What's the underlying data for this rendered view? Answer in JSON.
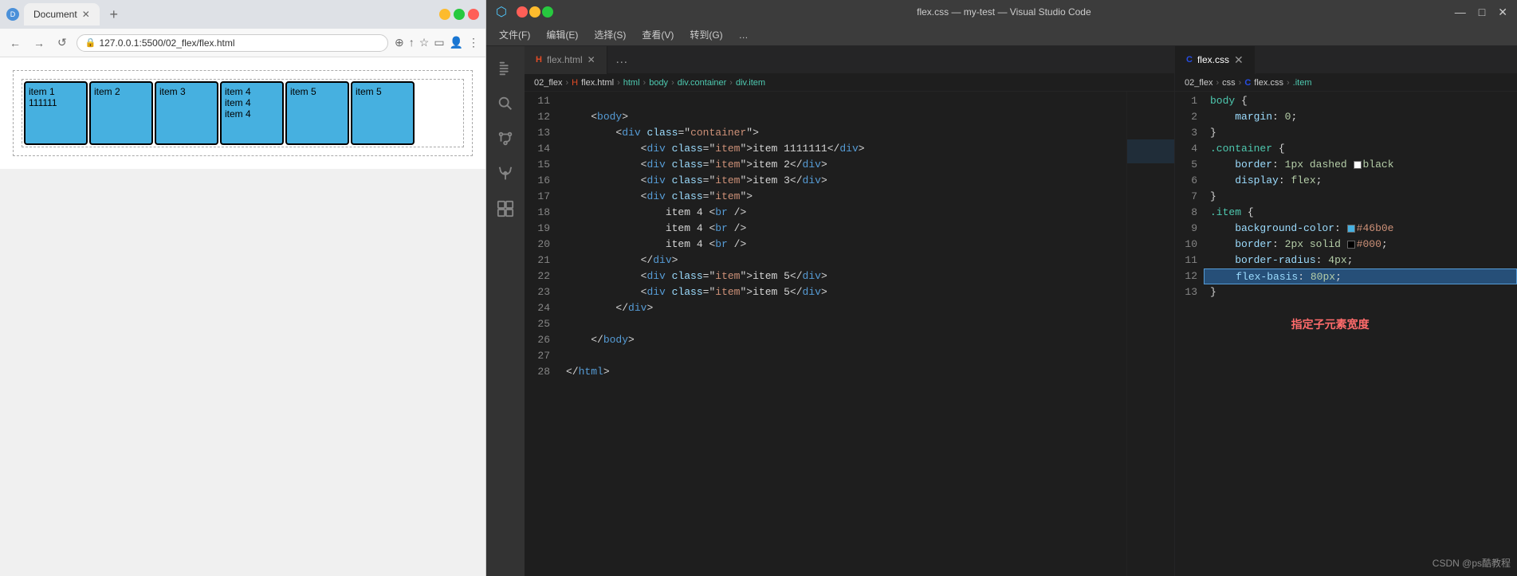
{
  "browser": {
    "tab_title": "Document",
    "url": "127.0.0.1:5500/02_flex/flex.html",
    "favicon": "⊕"
  },
  "preview": {
    "items": [
      {
        "label": "item 1111111",
        "tall": true
      },
      {
        "label": "item 2",
        "tall": false
      },
      {
        "label": "item 3",
        "tall": false
      },
      {
        "label": "item 4\nitem 4\nitem 4",
        "tall": true
      },
      {
        "label": "item 5",
        "tall": false
      },
      {
        "label": "item 5",
        "tall": false
      }
    ]
  },
  "vscode": {
    "title": "flex.css — my-test — Visual Studio Code",
    "menu": [
      "文件(F)",
      "编辑(E)",
      "选择(S)",
      "查看(V)",
      "转到(G)",
      "…"
    ],
    "html_tab": "flex.html",
    "css_tab": "flex.css",
    "html_breadcrumb": "02_flex > flex.html > html > body > div.container > div.item",
    "css_breadcrumb": "02_flex > css > flex.css > .item",
    "html_lines": [
      {
        "num": "11",
        "code": ""
      },
      {
        "num": "12",
        "code": "    <body>"
      },
      {
        "num": "13",
        "code": "        <div class=\"container\">"
      },
      {
        "num": "14",
        "code": "            <div class=\"item\">item 1111111</div>"
      },
      {
        "num": "15",
        "code": "            <div class=\"item\">item 2</div>"
      },
      {
        "num": "16",
        "code": "            <div class=\"item\">item 3</div>"
      },
      {
        "num": "17",
        "code": "            <div class=\"item\">"
      },
      {
        "num": "18",
        "code": "                item 4 <br />"
      },
      {
        "num": "19",
        "code": "                item 4 <br />"
      },
      {
        "num": "20",
        "code": "                item 4 <br />"
      },
      {
        "num": "21",
        "code": "            </div>"
      },
      {
        "num": "22",
        "code": "            <div class=\"item\">item 5</div>"
      },
      {
        "num": "23",
        "code": "            <div class=\"item\">item 5</div>"
      },
      {
        "num": "24",
        "code": "        </div>"
      },
      {
        "num": "25",
        "code": ""
      },
      {
        "num": "26",
        "code": "    </body>"
      },
      {
        "num": "27",
        "code": ""
      },
      {
        "num": "28",
        "code": "</html>"
      }
    ],
    "css_lines": [
      {
        "num": "1",
        "code": "body {",
        "highlight": false
      },
      {
        "num": "2",
        "code": "    margin: 0;",
        "highlight": false
      },
      {
        "num": "3",
        "code": "}",
        "highlight": false
      },
      {
        "num": "4",
        "code": ".container {",
        "highlight": false
      },
      {
        "num": "5",
        "code": "    border: 1px dashed  black",
        "highlight": false,
        "swatch": "#ffffff",
        "swatch_pos": "border"
      },
      {
        "num": "6",
        "code": "    display: flex;",
        "highlight": false
      },
      {
        "num": "7",
        "code": "}",
        "highlight": false
      },
      {
        "num": "8",
        "code": ".item {",
        "highlight": false
      },
      {
        "num": "9",
        "code": "    background-color:  #46b0e",
        "highlight": false,
        "swatch": "#46b0e0"
      },
      {
        "num": "10",
        "code": "    border: 2px solid  #000;",
        "highlight": false,
        "swatch": "#000000"
      },
      {
        "num": "11",
        "code": "    border-radius: 4px;",
        "highlight": false
      },
      {
        "num": "12",
        "code": "    flex-basis: 80px;",
        "highlight": true
      },
      {
        "num": "13",
        "code": "}",
        "highlight": false
      }
    ],
    "annotation": "指定子元素宽度",
    "watermark": "CSDN @ps酷教程"
  }
}
